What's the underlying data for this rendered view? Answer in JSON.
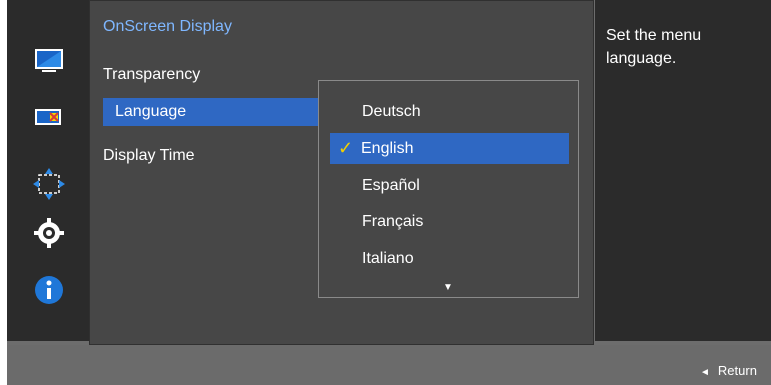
{
  "panel": {
    "title": "OnScreen Display"
  },
  "menu": {
    "items": [
      {
        "label": "Transparency"
      },
      {
        "label": "Language"
      },
      {
        "label": "Display Time"
      }
    ]
  },
  "dropdown": {
    "options": [
      "Deutsch",
      "English",
      "Español",
      "Français",
      "Italiano"
    ],
    "selected": "English",
    "check": "✓",
    "scroll_down": "▼"
  },
  "help": {
    "text": "Set the menu language."
  },
  "footer": {
    "arrow": "◄",
    "return_label": "Return"
  },
  "sidebar": {
    "icons": [
      "monitor-icon",
      "picture-icon",
      "position-icon",
      "settings-icon",
      "info-icon"
    ]
  },
  "colors": {
    "accent": "#2f68c3",
    "title": "#7fb7ff",
    "check": "#f2d000",
    "background": "#474747",
    "dark_panel": "#2b2b2b"
  }
}
